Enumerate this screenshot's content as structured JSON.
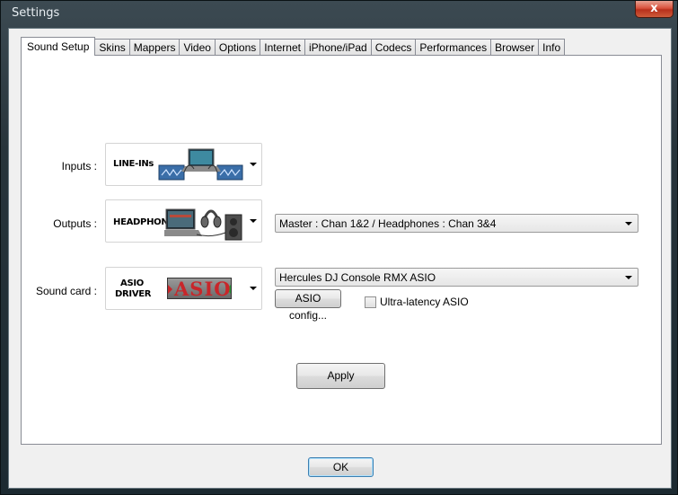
{
  "window": {
    "title": "Settings",
    "close_label": "x"
  },
  "tabs": [
    {
      "label": "Sound Setup",
      "active": true
    },
    {
      "label": "Skins"
    },
    {
      "label": "Mappers"
    },
    {
      "label": "Video"
    },
    {
      "label": "Options"
    },
    {
      "label": "Internet"
    },
    {
      "label": "iPhone/iPad"
    },
    {
      "label": "Codecs"
    },
    {
      "label": "Performances"
    },
    {
      "label": "Browser"
    },
    {
      "label": "Info"
    }
  ],
  "sound_setup": {
    "inputs": {
      "label": "Inputs :",
      "picker_caption": "LINE-INs"
    },
    "outputs": {
      "label": "Outputs :",
      "picker_caption": "HEADPHONES",
      "mapping_value": "Master : Chan 1&2 / Headphones : Chan 3&4"
    },
    "sound_card": {
      "label": "Sound card :",
      "picker_caption_line1": "ASIO",
      "picker_caption_line2": "DRIVER",
      "logo_text": "ASIO",
      "device_value": "Hercules DJ Console RMX ASIO",
      "config_button": "ASIO config...",
      "ultra_latency_label": "Ultra-latency ASIO",
      "ultra_latency_checked": false
    },
    "apply_button": "Apply"
  },
  "footer": {
    "ok_button": "OK"
  },
  "colors": {
    "glass_dark": "#1c2a31",
    "close_red": "#c8412a",
    "asio_red": "#c8262a",
    "asio_green": "#2a9a3a"
  }
}
